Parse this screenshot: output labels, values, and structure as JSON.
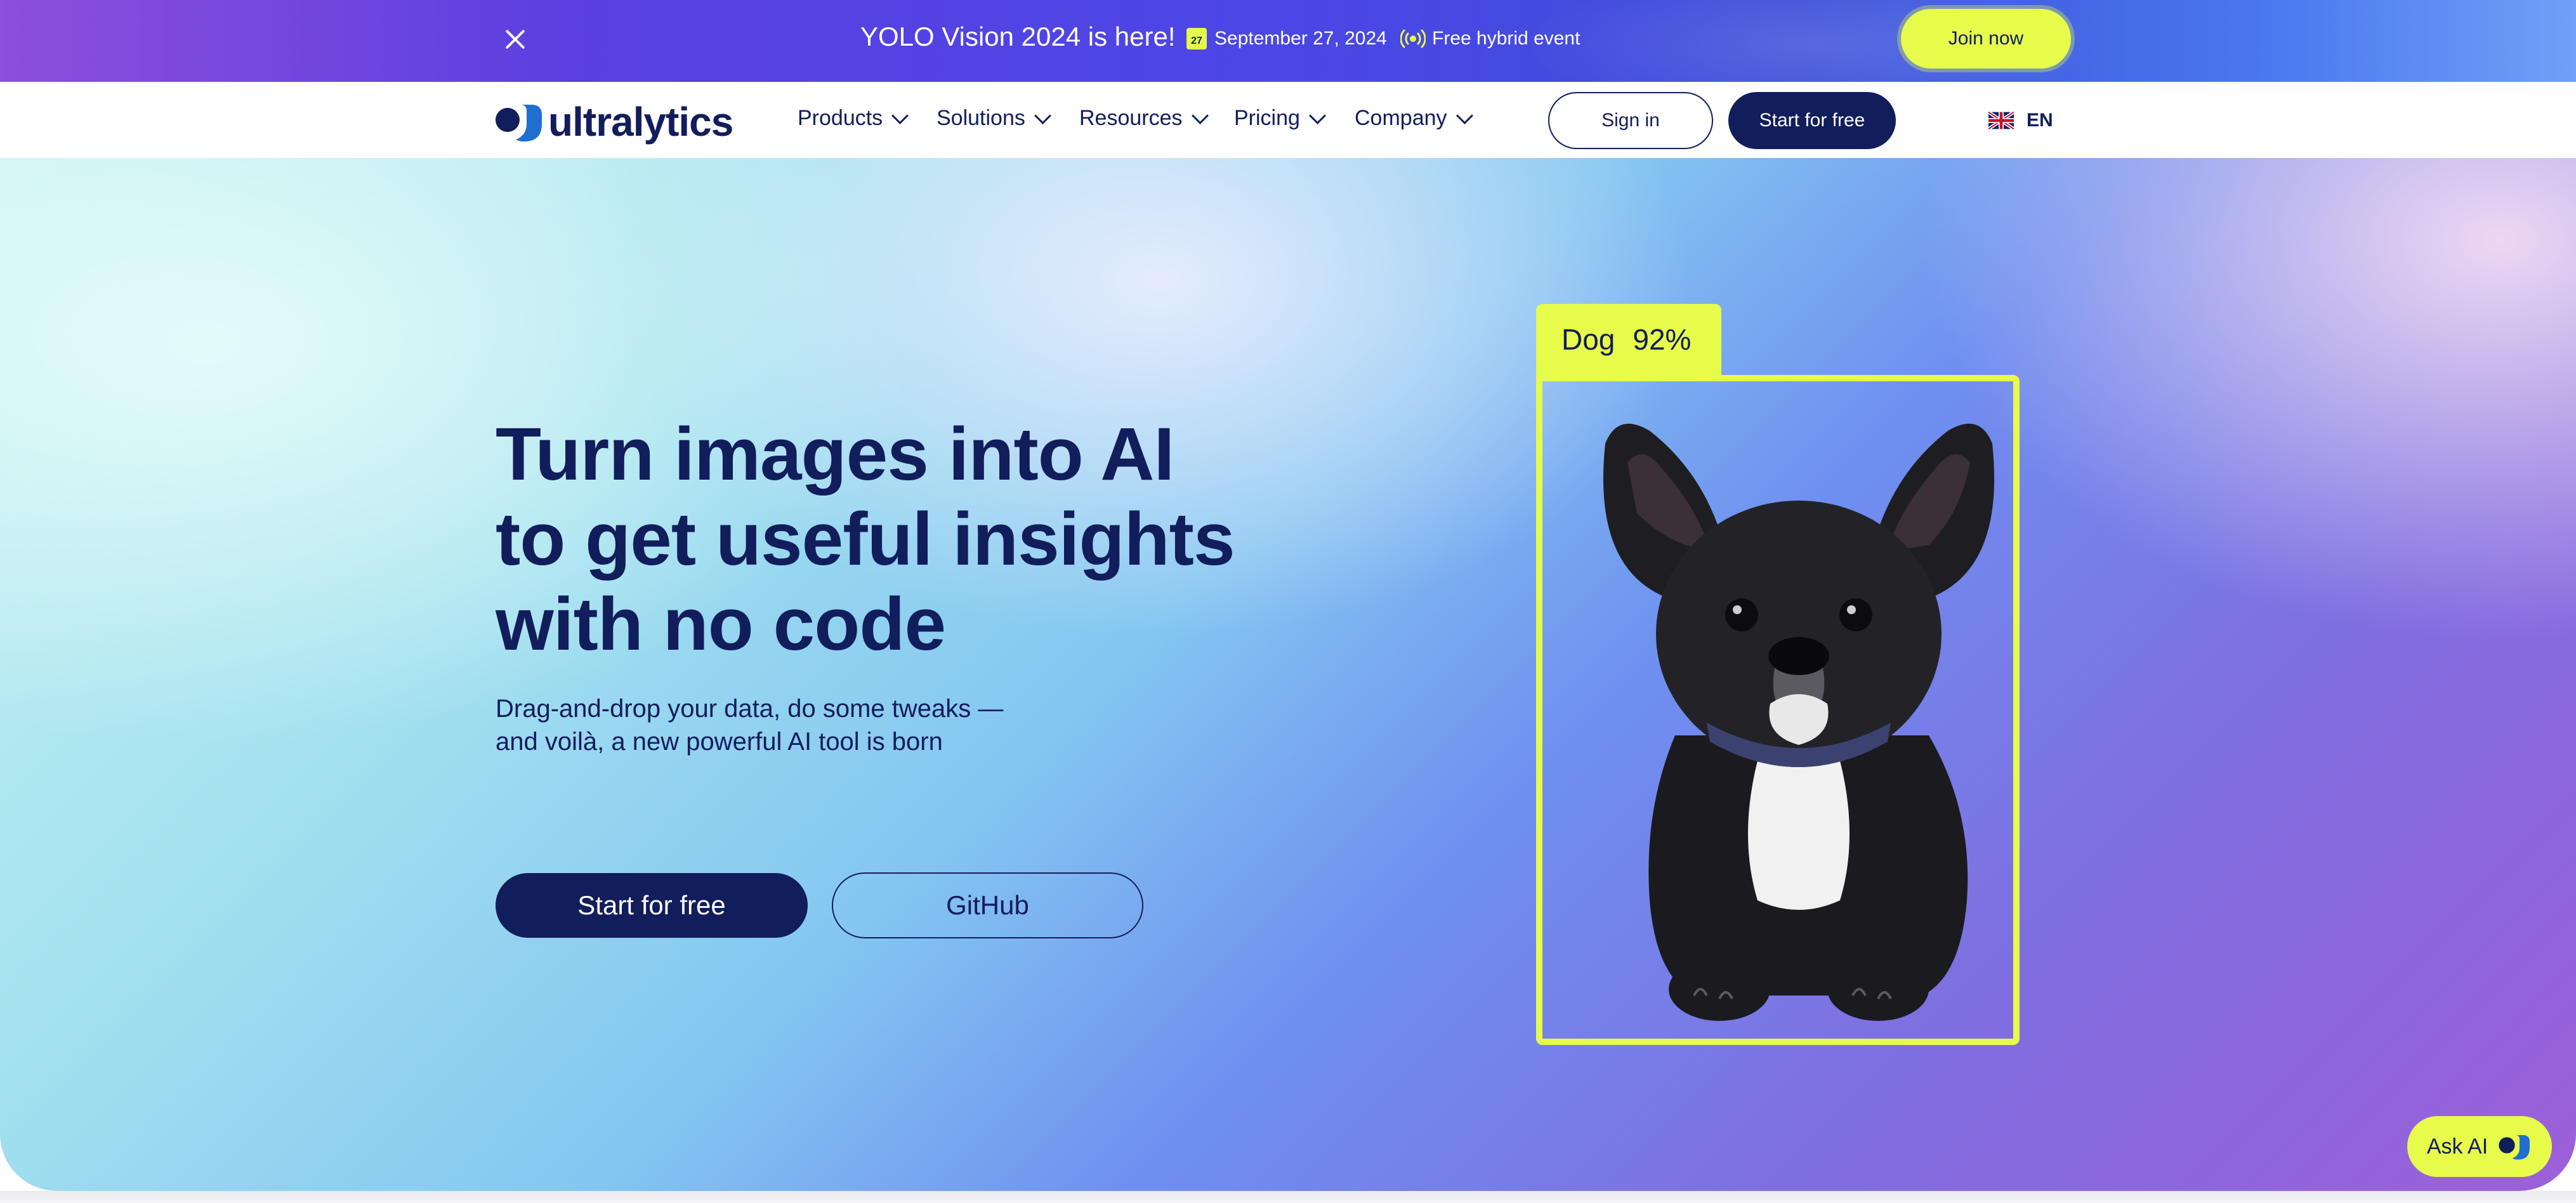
{
  "announcement": {
    "title": "YOLO Vision 2024 is here!",
    "date": "September 27, 2024",
    "calendar_day": "27",
    "event_type": "Free hybrid event",
    "join_label": "Join now",
    "close_icon": "close-icon"
  },
  "nav": {
    "logo_text": "ultralytics",
    "items": [
      {
        "label": "Products"
      },
      {
        "label": "Solutions"
      },
      {
        "label": "Resources"
      },
      {
        "label": "Pricing"
      },
      {
        "label": "Company"
      }
    ],
    "sign_in": "Sign in",
    "start_free": "Start for free",
    "language": "EN",
    "flag_icon": "uk-flag-icon"
  },
  "hero": {
    "title_lines": [
      "Turn images into AI",
      "to get useful insights",
      "with no code"
    ],
    "subtitle_lines": [
      "Drag-and-drop your data, do some tweaks —",
      "and voilà, a new powerful AI tool is born"
    ],
    "cta_primary": "Start for free",
    "cta_secondary": "GitHub"
  },
  "detection": {
    "label": "Dog",
    "confidence": "92%"
  },
  "ask_ai": {
    "label": "Ask AI"
  },
  "colors": {
    "navy": "#121d5c",
    "lime": "#e6fb4a",
    "banner_purple": "#5b3fe0"
  }
}
